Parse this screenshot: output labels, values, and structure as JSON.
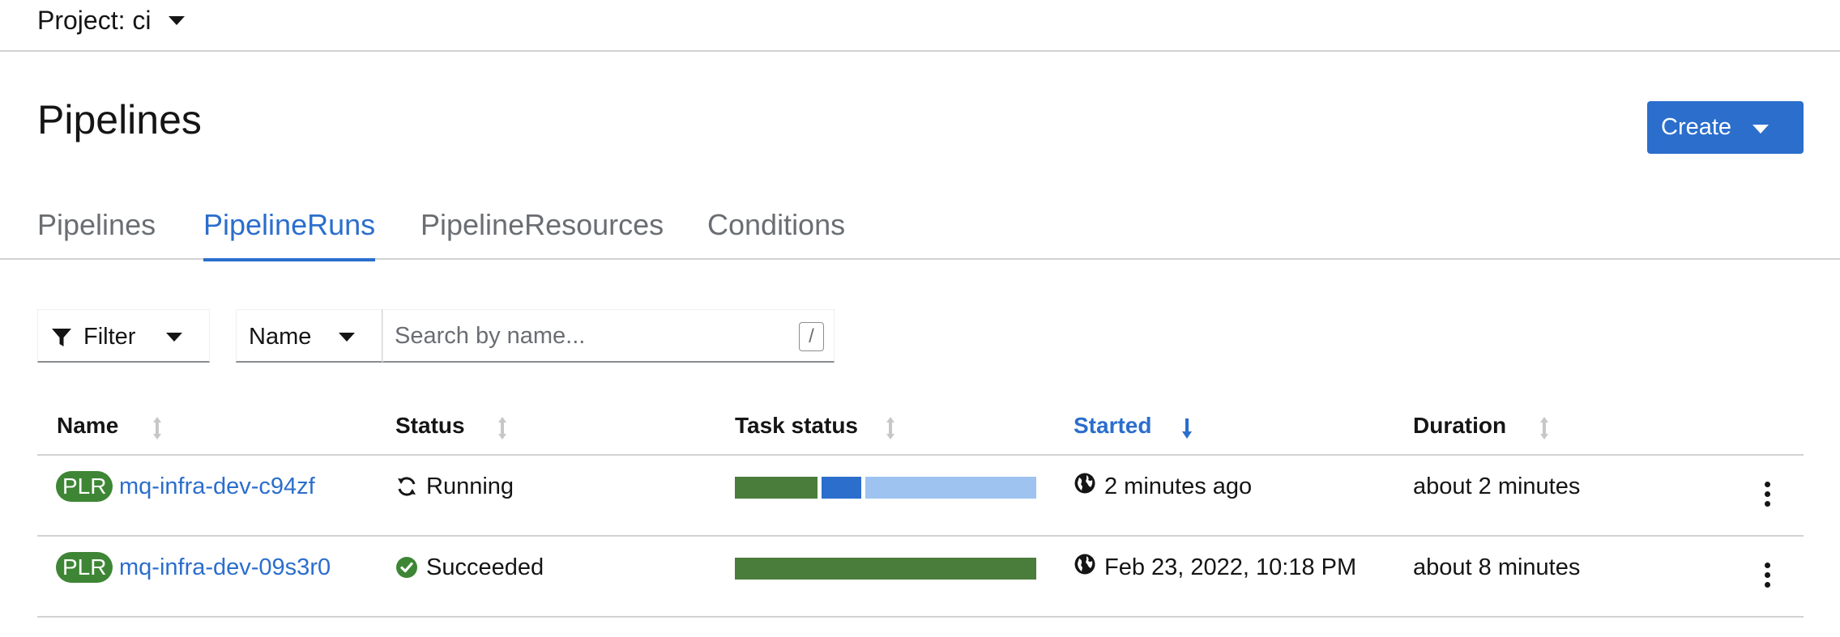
{
  "project_bar": {
    "label": "Project: ci"
  },
  "page": {
    "title": "Pipelines",
    "create_label": "Create"
  },
  "tabs": [
    {
      "label": "Pipelines",
      "active": false
    },
    {
      "label": "PipelineRuns",
      "active": true
    },
    {
      "label": "PipelineResources",
      "active": false
    },
    {
      "label": "Conditions",
      "active": false
    }
  ],
  "toolbar": {
    "filter_label": "Filter",
    "name_select_value": "Name",
    "search_placeholder": "Search by name...",
    "search_value": "",
    "shortcut_key": "/"
  },
  "table": {
    "columns": [
      {
        "label": "Name",
        "sort": "none"
      },
      {
        "label": "Status",
        "sort": "none"
      },
      {
        "label": "Task status",
        "sort": "none"
      },
      {
        "label": "Started",
        "sort": "descending"
      },
      {
        "label": "Duration",
        "sort": "none"
      }
    ],
    "rows": [
      {
        "badge": "PLR",
        "name": "mq-infra-dev-c94zf",
        "status": "Running",
        "status_icon": "sync-icon",
        "task_status": {
          "succeeded": 1,
          "running": 1,
          "pending": 2
        },
        "started": "2 minutes ago",
        "duration": "about 2 minutes"
      },
      {
        "badge": "PLR",
        "name": "mq-infra-dev-09s3r0",
        "status": "Succeeded",
        "status_icon": "check-circle-icon",
        "task_status": {
          "succeeded": 1,
          "running": 0,
          "pending": 0
        },
        "started": "Feb 23, 2022, 10:18 PM",
        "duration": "about 8 minutes"
      }
    ]
  },
  "colors": {
    "accent": "#2b6ecc",
    "success": "#3e8635",
    "task_succeeded": "#4a7c3b",
    "task_running": "#2b6ecc",
    "task_pending": "#9ec3f0"
  }
}
